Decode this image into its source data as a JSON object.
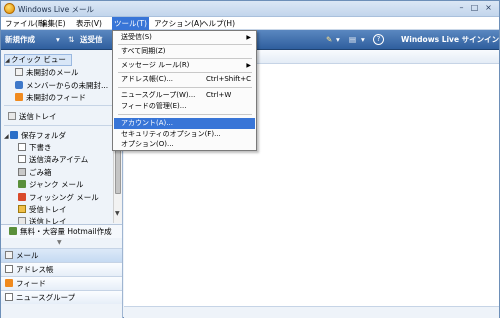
{
  "window": {
    "title": "Windows Live メール",
    "controls": [
      "–",
      "□",
      "×"
    ]
  },
  "menubar": [
    "ファイル(F)",
    "編集(E)",
    "表示(V)",
    "ツール(T)",
    "アクション(A)",
    "ヘルプ(H)"
  ],
  "toolbar": {
    "new": "新規作成",
    "new_dropdown": "▾",
    "sync": "送受信",
    "pen": "✎",
    "view_drop": "▾",
    "help": "?",
    "signin": "Windows Live サインイン"
  },
  "quickview": {
    "title": "クイック ビュー",
    "items": [
      "未開封のメール",
      "メンバーからの未開封...",
      "未開封のフィード"
    ]
  },
  "outbox": "送信トレイ",
  "store": {
    "title": "保存フォルダ",
    "folders": [
      "下書き",
      "送信済みアイテム",
      "ごみ箱",
      "ジャンク メール",
      "フィッシング メール",
      "受信トレイ",
      "送信トレイ"
    ]
  },
  "hotmail_link": "無料・大容量 Hotmail作成",
  "nav": [
    "メール",
    "アドレス帳",
    "フィード",
    "ニュースグループ"
  ],
  "dropdown": {
    "send_receive": "送受信(S)",
    "sync_all": "すべて同期(Z)",
    "message_rules": "メッセージ ルール(R)",
    "address_book": "アドレス帳(C)...",
    "address_book_shortcut": "Ctrl+Shift+C",
    "newsgroups": "ニュースグループ(W)...",
    "newsgroups_shortcut": "Ctrl+W",
    "feed_manager": "フィードの管理(E)...",
    "accounts": "アカウント(A)...",
    "security": "セキュリティのオプション(F)...",
    "options": "オプション(O)..."
  }
}
